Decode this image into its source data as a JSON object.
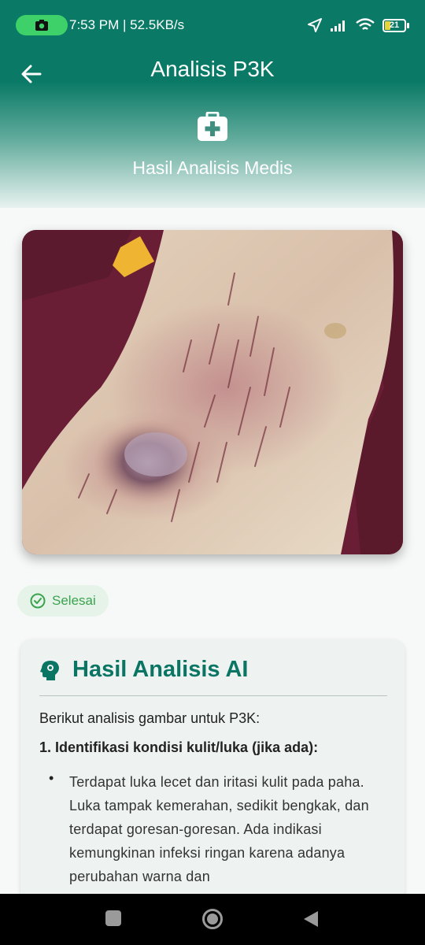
{
  "status_bar": {
    "time_speed": "7:53 PM | 52.5KB/s",
    "battery": "21"
  },
  "app_bar": {
    "title": "Analisis P3K",
    "subtitle": "Hasil Analisis Medis"
  },
  "photo": {
    "description_icon": "wound-photo"
  },
  "status_chip": {
    "label": "Selesai"
  },
  "analysis": {
    "title": "Hasil Analisis AI",
    "intro": "Berikut analisis gambar untuk P3K:",
    "section1_heading": "1. Identifikasi kondisi kulit/luka (jika ada):",
    "bullet1": "Terdapat luka lecet dan iritasi kulit pada paha.  Luka tampak kemerahan, sedikit bengkak, dan terdapat goresan-goresan. Ada indikasi kemungkinan infeksi ringan karena adanya perubahan warna dan"
  },
  "colors": {
    "primary": "#0a7a66",
    "success": "#3ba34f"
  }
}
